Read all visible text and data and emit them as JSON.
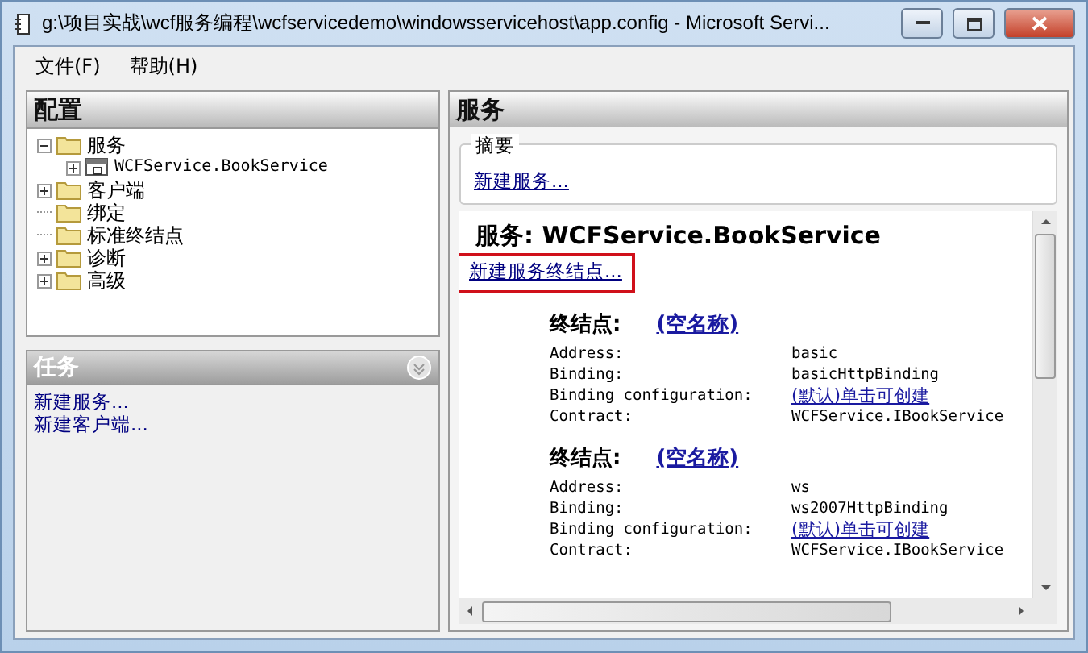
{
  "window": {
    "title": "g:\\项目实战\\wcf服务编程\\wcfservicedemo\\windowsservicehost\\app.config - Microsoft Servi..."
  },
  "menu": [
    {
      "label": "文件(F)"
    },
    {
      "label": "帮助(H)"
    }
  ],
  "config_panel": {
    "title": "配置",
    "tree": [
      {
        "label": "服务",
        "kind": "folder",
        "expanded": true,
        "children": [
          {
            "label": "WCFService.BookService",
            "kind": "service",
            "expanded": false
          }
        ]
      },
      {
        "label": "客户端",
        "kind": "folder",
        "expanded": false
      },
      {
        "label": "绑定",
        "kind": "folder"
      },
      {
        "label": "标准终结点",
        "kind": "folder"
      },
      {
        "label": "诊断",
        "kind": "folder",
        "expanded": false
      },
      {
        "label": "高级",
        "kind": "folder",
        "expanded": false
      }
    ]
  },
  "tasks_panel": {
    "title": "任务",
    "links": [
      "新建服务...",
      "新建客户端..."
    ]
  },
  "service_panel": {
    "title": "服务",
    "summary": {
      "label": "摘要",
      "link": "新建服务..."
    },
    "detail": {
      "heading": "服务: WCFService.BookService",
      "link": {
        "label": "新建服务终结点...",
        "highlighted": true
      },
      "endpoints": [
        {
          "label": "终结点:",
          "name": "(空名称)",
          "properties": [
            {
              "label": "Address:",
              "value": "basic",
              "kind": "text"
            },
            {
              "label": "Binding:",
              "value": "basicHttpBinding",
              "kind": "text"
            },
            {
              "label": "Binding configuration:",
              "value": "(默认)单击可创建",
              "kind": "link"
            },
            {
              "label": "Contract:",
              "value": "WCFService.IBookService",
              "kind": "text"
            }
          ]
        },
        {
          "label": "终结点:",
          "name": "(空名称)",
          "properties": [
            {
              "label": "Address:",
              "value": "ws",
              "kind": "text"
            },
            {
              "label": "Binding:",
              "value": "ws2007HttpBinding",
              "kind": "text"
            },
            {
              "label": "Binding configuration:",
              "value": "(默认)单击可创建",
              "kind": "link"
            },
            {
              "label": "Contract:",
              "value": "WCFService.IBookService",
              "kind": "text"
            }
          ]
        }
      ]
    }
  }
}
